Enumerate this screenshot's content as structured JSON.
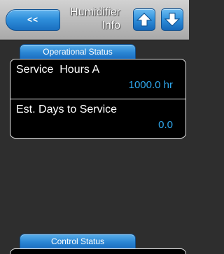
{
  "header": {
    "back_label": "<<",
    "title_line1": "Humidifier",
    "title_line2": "Info",
    "up_icon": "arrow-up-icon",
    "down_icon": "arrow-down-icon"
  },
  "operational_status": {
    "tab_label": "Operational Status",
    "rows": [
      {
        "label": "Service  Hours A",
        "value": "1000.0 hr"
      },
      {
        "label": "Est. Days to Service",
        "value": "0.0"
      }
    ]
  },
  "control_status": {
    "tab_label": "Control Status"
  },
  "colors": {
    "accent_blue": "#2b86d4",
    "value_blue": "#2fa8ee",
    "background": "#2e2e2e"
  }
}
